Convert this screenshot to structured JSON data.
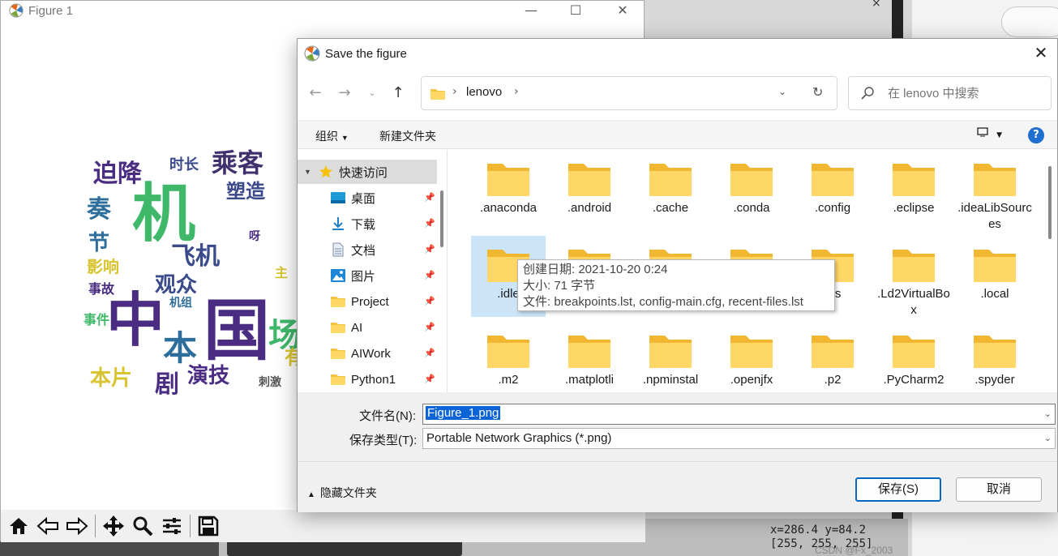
{
  "figure": {
    "title": "Figure 1",
    "controls": [
      "—",
      "☐",
      "✕"
    ],
    "wordcloud": [
      "机",
      "中",
      "国",
      "本",
      "乘客",
      "时长",
      "飞机",
      "塑造",
      "观众",
      "迫降",
      "影响",
      "事故",
      "演技",
      "剧",
      "刺激",
      "奏",
      "节",
      "机组",
      "本片",
      "主",
      "场",
      "呀",
      "事件",
      "有"
    ]
  },
  "dialog": {
    "title": "Save the figure",
    "close": "✕",
    "breadcrumb": "lenovo",
    "search_placeholder": "在 lenovo 中搜索",
    "organize": "组织",
    "new_folder": "新建文件夹",
    "help": "?",
    "sidebar": [
      {
        "label": "快速访问",
        "icon": "star-icon"
      },
      {
        "label": "桌面",
        "icon": "desktop-icon",
        "pinned": true
      },
      {
        "label": "下载",
        "icon": "download-icon",
        "pinned": true
      },
      {
        "label": "文档",
        "icon": "document-icon",
        "pinned": true
      },
      {
        "label": "图片",
        "icon": "pictures-icon",
        "pinned": true
      },
      {
        "label": "Project",
        "icon": "folder-icon",
        "pinned": true
      },
      {
        "label": "AI",
        "icon": "folder-icon",
        "pinned": true
      },
      {
        "label": "AIWork",
        "icon": "folder-icon",
        "pinned": true
      },
      {
        "label": "Python1",
        "icon": "folder-icon",
        "pinned": true
      }
    ],
    "files_row1": [
      ".anaconda",
      ".android",
      ".cache",
      ".conda",
      ".config",
      ".eclipse",
      ".ideaLibSources"
    ],
    "files_row2": [
      ".idle",
      "",
      "",
      "",
      "ras",
      ".Ld2VirtualBox",
      ".local"
    ],
    "files_row3": [
      ".m2",
      ".matplotli",
      ".npminstal",
      ".openjfx",
      ".p2",
      ".PyCharm2",
      ".spyder"
    ],
    "tooltip": {
      "line1": "创建日期: 2021-10-20 0:24",
      "line2": "大小: 71 字节",
      "line3": "文件: breakpoints.lst, config-main.cfg, recent-files.lst"
    },
    "filename_label": "文件名(N):",
    "filename_value": "Figure_1.png",
    "filetype_label": "保存类型(T):",
    "filetype_value": "Portable Network Graphics (*.png)",
    "hide_folders": "隐藏文件夹",
    "save_button": "保存(S)",
    "cancel_button": "取消"
  },
  "status": {
    "coords": "x=286.4 y=84.2",
    "rgb": "[255, 255, 255]"
  },
  "watermark": "CSDN @Fx_2003",
  "watermark_behind": "CSDN @Fx_2003"
}
